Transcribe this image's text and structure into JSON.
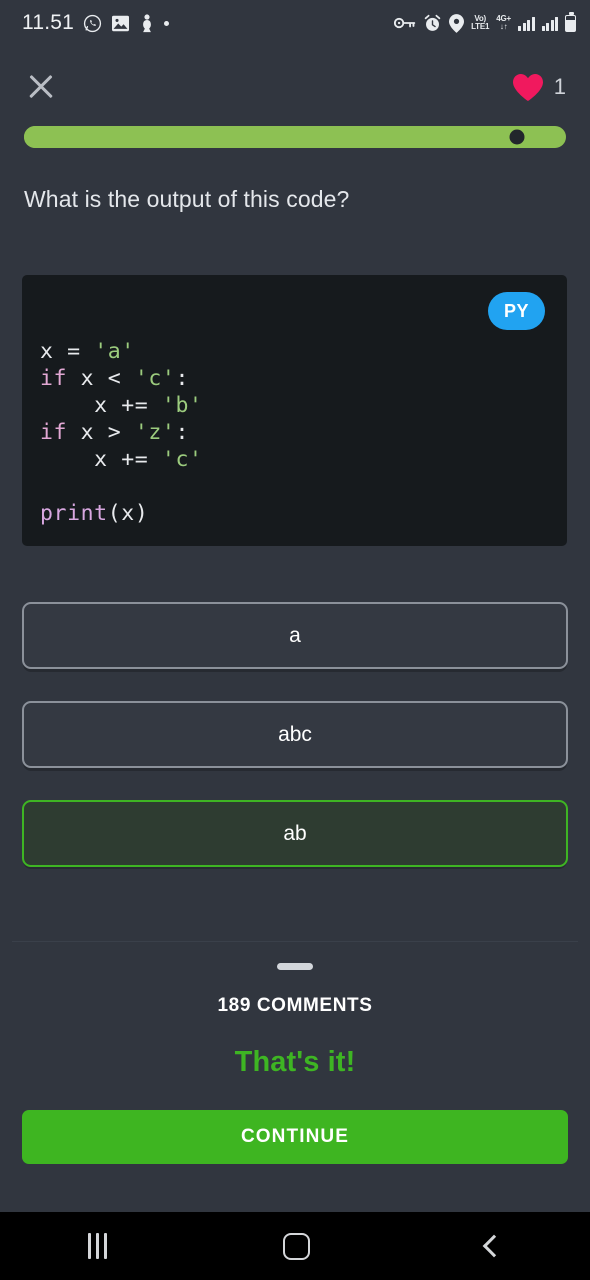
{
  "statusbar": {
    "time": "11.51",
    "left_icons": [
      "whatsapp-icon",
      "image-icon",
      "figure-icon",
      "dot-icon"
    ],
    "network_top": "Vo)",
    "network_bottom": "LTE1",
    "data_top": "4G+",
    "data_bottom": "↓↑",
    "right_icons": [
      "key-icon",
      "alarm-icon",
      "location-icon",
      "signal-bars-icon",
      "signal-bars-icon",
      "battery-icon"
    ]
  },
  "header": {
    "close_label": "×",
    "hearts_count": "1",
    "heart_color": "#f0195e"
  },
  "progress": {
    "percent": 91,
    "track_color": "#8dc153",
    "fill_color": "#8dc153"
  },
  "question": {
    "text": "What is the output of this code?"
  },
  "code": {
    "language_badge": "PY",
    "badge_color": "#21a3f1",
    "lines": [
      [
        {
          "t": "x = ",
          "c": "pl"
        },
        {
          "t": "'a'",
          "c": "str"
        }
      ],
      [
        {
          "t": "if",
          "c": "kw"
        },
        {
          "t": " x < ",
          "c": "pl"
        },
        {
          "t": "'c'",
          "c": "str"
        },
        {
          "t": ":",
          "c": "pl"
        }
      ],
      [
        {
          "t": "    x += ",
          "c": "pl"
        },
        {
          "t": "'b'",
          "c": "str"
        }
      ],
      [
        {
          "t": "if",
          "c": "kw"
        },
        {
          "t": " x > ",
          "c": "pl"
        },
        {
          "t": "'z'",
          "c": "str"
        },
        {
          "t": ":",
          "c": "pl"
        }
      ],
      [
        {
          "t": "    x += ",
          "c": "pl"
        },
        {
          "t": "'c'",
          "c": "str"
        }
      ],
      [
        {
          "t": "",
          "c": "pl"
        }
      ],
      [
        {
          "t": "print",
          "c": "fn"
        },
        {
          "t": "(x)",
          "c": "pl"
        }
      ]
    ]
  },
  "options": [
    {
      "label": "a",
      "selected": false
    },
    {
      "label": "abc",
      "selected": false
    },
    {
      "label": "ab",
      "selected": true
    }
  ],
  "bottom": {
    "comments_label": "189 COMMENTS",
    "verdict": "That's it!",
    "verdict_color": "#3eb523",
    "continue_label": "CONTINUE",
    "continue_color": "#3eb521"
  },
  "navbar": {
    "items": [
      "recents-icon",
      "home-icon",
      "back-icon"
    ]
  }
}
